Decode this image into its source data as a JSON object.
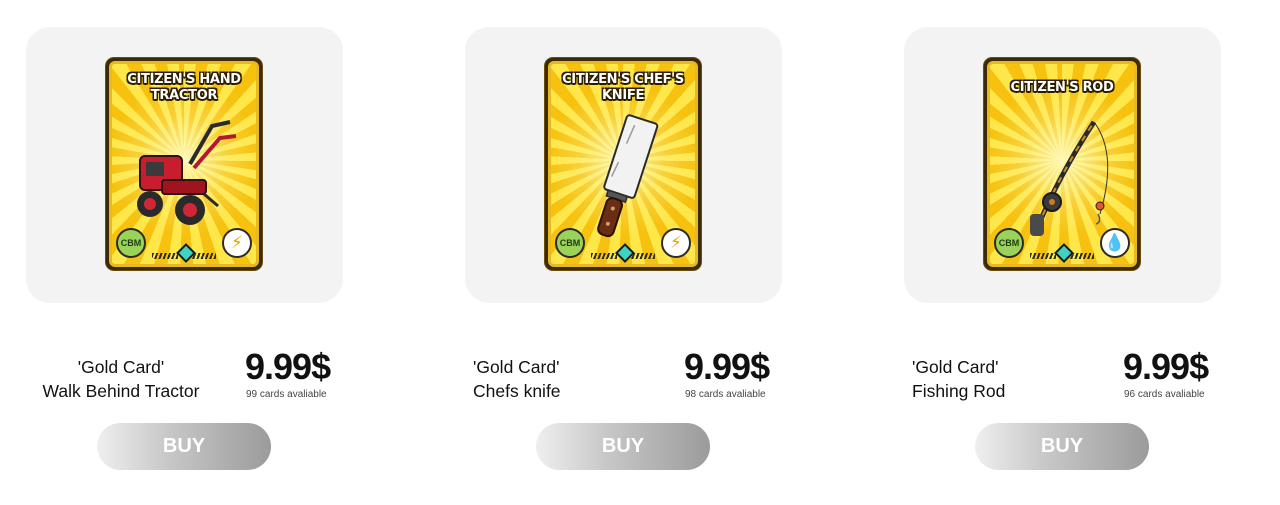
{
  "products": [
    {
      "card_title_line1": "CITIZEN'S HAND",
      "card_title_line2": "TRACTOR",
      "card_badge": "CBM",
      "card_type_icon": "lightning-icon",
      "label_line1": "'Gold Card'",
      "label_line2": "Walk Behind Tractor",
      "price": "9.99$",
      "availability": "99 cards avaliable",
      "buy_label": "BUY"
    },
    {
      "card_title_line1": "CITIZEN'S CHEF'S",
      "card_title_line2": "KNIFE",
      "card_badge": "CBM",
      "card_type_icon": "lightning-icon",
      "label_line1": "'Gold Card'",
      "label_line2": "Chefs knife",
      "price": "9.99$",
      "availability": "98 cards avaliable",
      "buy_label": "BUY"
    },
    {
      "card_title_line1": "CITIZEN'S ROD",
      "card_title_line2": "",
      "card_badge": "CBM",
      "card_type_icon": "water-drop-icon",
      "label_line1": "'Gold Card'",
      "label_line2": "Fishing Rod",
      "price": "9.99$",
      "availability": "96 cards avaliable",
      "buy_label": "BUY"
    }
  ],
  "colors": {
    "card_gold": "#f6c20f",
    "card_light": "#ffe74a",
    "panel_bg": "#f3f3f3",
    "button_gradient_start": "#efefef",
    "button_gradient_end": "#9b9b9b"
  }
}
